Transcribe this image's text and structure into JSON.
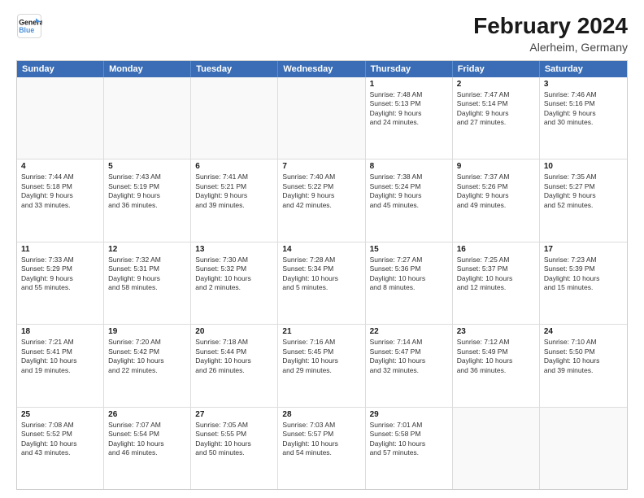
{
  "header": {
    "logo_line1": "General",
    "logo_line2": "Blue",
    "main_title": "February 2024",
    "subtitle": "Alerheim, Germany"
  },
  "calendar": {
    "days_of_week": [
      "Sunday",
      "Monday",
      "Tuesday",
      "Wednesday",
      "Thursday",
      "Friday",
      "Saturday"
    ],
    "weeks": [
      [
        {
          "day": "",
          "info": ""
        },
        {
          "day": "",
          "info": ""
        },
        {
          "day": "",
          "info": ""
        },
        {
          "day": "",
          "info": ""
        },
        {
          "day": "1",
          "info": "Sunrise: 7:48 AM\nSunset: 5:13 PM\nDaylight: 9 hours\nand 24 minutes."
        },
        {
          "day": "2",
          "info": "Sunrise: 7:47 AM\nSunset: 5:14 PM\nDaylight: 9 hours\nand 27 minutes."
        },
        {
          "day": "3",
          "info": "Sunrise: 7:46 AM\nSunset: 5:16 PM\nDaylight: 9 hours\nand 30 minutes."
        }
      ],
      [
        {
          "day": "4",
          "info": "Sunrise: 7:44 AM\nSunset: 5:18 PM\nDaylight: 9 hours\nand 33 minutes."
        },
        {
          "day": "5",
          "info": "Sunrise: 7:43 AM\nSunset: 5:19 PM\nDaylight: 9 hours\nand 36 minutes."
        },
        {
          "day": "6",
          "info": "Sunrise: 7:41 AM\nSunset: 5:21 PM\nDaylight: 9 hours\nand 39 minutes."
        },
        {
          "day": "7",
          "info": "Sunrise: 7:40 AM\nSunset: 5:22 PM\nDaylight: 9 hours\nand 42 minutes."
        },
        {
          "day": "8",
          "info": "Sunrise: 7:38 AM\nSunset: 5:24 PM\nDaylight: 9 hours\nand 45 minutes."
        },
        {
          "day": "9",
          "info": "Sunrise: 7:37 AM\nSunset: 5:26 PM\nDaylight: 9 hours\nand 49 minutes."
        },
        {
          "day": "10",
          "info": "Sunrise: 7:35 AM\nSunset: 5:27 PM\nDaylight: 9 hours\nand 52 minutes."
        }
      ],
      [
        {
          "day": "11",
          "info": "Sunrise: 7:33 AM\nSunset: 5:29 PM\nDaylight: 9 hours\nand 55 minutes."
        },
        {
          "day": "12",
          "info": "Sunrise: 7:32 AM\nSunset: 5:31 PM\nDaylight: 9 hours\nand 58 minutes."
        },
        {
          "day": "13",
          "info": "Sunrise: 7:30 AM\nSunset: 5:32 PM\nDaylight: 10 hours\nand 2 minutes."
        },
        {
          "day": "14",
          "info": "Sunrise: 7:28 AM\nSunset: 5:34 PM\nDaylight: 10 hours\nand 5 minutes."
        },
        {
          "day": "15",
          "info": "Sunrise: 7:27 AM\nSunset: 5:36 PM\nDaylight: 10 hours\nand 8 minutes."
        },
        {
          "day": "16",
          "info": "Sunrise: 7:25 AM\nSunset: 5:37 PM\nDaylight: 10 hours\nand 12 minutes."
        },
        {
          "day": "17",
          "info": "Sunrise: 7:23 AM\nSunset: 5:39 PM\nDaylight: 10 hours\nand 15 minutes."
        }
      ],
      [
        {
          "day": "18",
          "info": "Sunrise: 7:21 AM\nSunset: 5:41 PM\nDaylight: 10 hours\nand 19 minutes."
        },
        {
          "day": "19",
          "info": "Sunrise: 7:20 AM\nSunset: 5:42 PM\nDaylight: 10 hours\nand 22 minutes."
        },
        {
          "day": "20",
          "info": "Sunrise: 7:18 AM\nSunset: 5:44 PM\nDaylight: 10 hours\nand 26 minutes."
        },
        {
          "day": "21",
          "info": "Sunrise: 7:16 AM\nSunset: 5:45 PM\nDaylight: 10 hours\nand 29 minutes."
        },
        {
          "day": "22",
          "info": "Sunrise: 7:14 AM\nSunset: 5:47 PM\nDaylight: 10 hours\nand 32 minutes."
        },
        {
          "day": "23",
          "info": "Sunrise: 7:12 AM\nSunset: 5:49 PM\nDaylight: 10 hours\nand 36 minutes."
        },
        {
          "day": "24",
          "info": "Sunrise: 7:10 AM\nSunset: 5:50 PM\nDaylight: 10 hours\nand 39 minutes."
        }
      ],
      [
        {
          "day": "25",
          "info": "Sunrise: 7:08 AM\nSunset: 5:52 PM\nDaylight: 10 hours\nand 43 minutes."
        },
        {
          "day": "26",
          "info": "Sunrise: 7:07 AM\nSunset: 5:54 PM\nDaylight: 10 hours\nand 46 minutes."
        },
        {
          "day": "27",
          "info": "Sunrise: 7:05 AM\nSunset: 5:55 PM\nDaylight: 10 hours\nand 50 minutes."
        },
        {
          "day": "28",
          "info": "Sunrise: 7:03 AM\nSunset: 5:57 PM\nDaylight: 10 hours\nand 54 minutes."
        },
        {
          "day": "29",
          "info": "Sunrise: 7:01 AM\nSunset: 5:58 PM\nDaylight: 10 hours\nand 57 minutes."
        },
        {
          "day": "",
          "info": ""
        },
        {
          "day": "",
          "info": ""
        }
      ]
    ]
  }
}
